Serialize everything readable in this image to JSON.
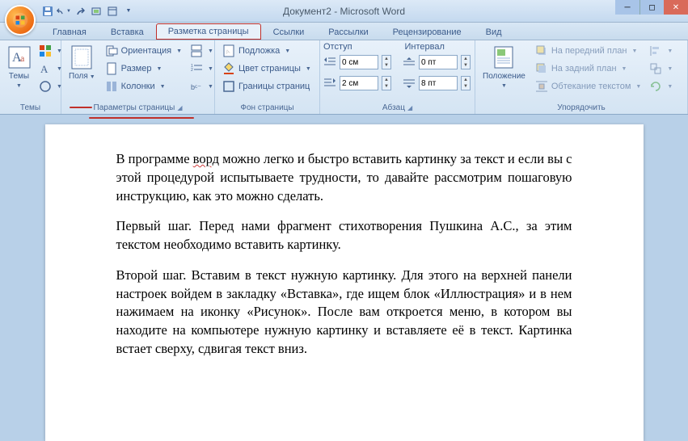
{
  "title": "Документ2 - Microsoft Word",
  "tabs": {
    "home": "Главная",
    "insert": "Вставка",
    "layout": "Разметка страницы",
    "references": "Ссылки",
    "mailings": "Рассылки",
    "review": "Рецензирование",
    "view": "Вид"
  },
  "groups": {
    "themes": {
      "label": "Темы",
      "themes_btn": "Темы"
    },
    "page_setup": {
      "label": "Параметры страницы",
      "margins": "Поля",
      "orientation": "Ориентация",
      "size": "Размер",
      "columns": "Колонки"
    },
    "page_bg": {
      "label": "Фон страницы",
      "watermark": "Подложка",
      "color": "Цвет страницы",
      "borders": "Границы страниц"
    },
    "indent": {
      "label_indent": "Отступ",
      "left": "0 см",
      "right": "2 см"
    },
    "spacing": {
      "label_spacing": "Интервал",
      "before": "0 пт",
      "after": "8 пт"
    },
    "paragraph": {
      "label": "Абзац"
    },
    "arrange": {
      "label": "Упорядочить",
      "position": "Положение",
      "front": "На передний план",
      "back": "На задний план",
      "wrap": "Обтекание текстом"
    }
  },
  "body": {
    "p1a": "В программе ",
    "p1_sq": "ворд",
    "p1b": " можно легко и быстро вставить картинку за текст и если вы с этой процедурой испытываете трудности, то давайте рассмотрим пошаговую инструкцию, как это можно сделать.",
    "p2": "Первый шаг. Перед нами фрагмент стихотворения Пушкина А.С., за этим текстом необходимо вставить картинку.",
    "p3": "Второй шаг. Вставим в текст нужную картинку. Для этого на верхней панели настроек войдем в закладку «Вставка», где ищем блок «Иллюстрация» и в нем нажимаем на иконку «Рисунок». После вам откроется меню, в котором вы находите на компьютере нужную картинку и вставляете её в текст. Картинка встает сверху, сдвигая текст вниз."
  }
}
